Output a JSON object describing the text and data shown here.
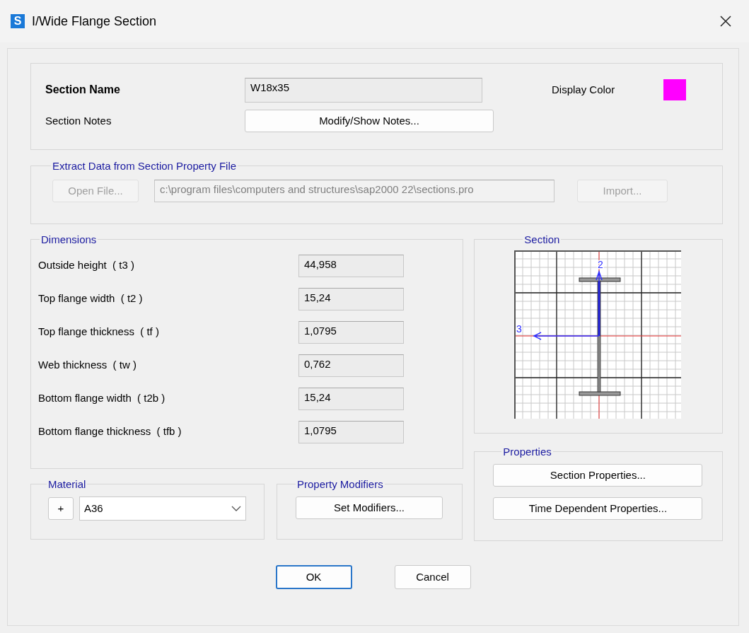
{
  "window": {
    "title": "I/Wide Flange Section",
    "app_icon": "S"
  },
  "section": {
    "name_label": "Section Name",
    "name_value": "W18x35",
    "notes_label": "Section Notes",
    "notes_button": "Modify/Show Notes...",
    "display_color": {
      "label": "Display Color",
      "color": "#ff00ff"
    }
  },
  "extract": {
    "title": "Extract Data from Section Property File",
    "open_button": {
      "label": "Open File...",
      "disabled": true
    },
    "file_path": {
      "value": "c:\\program files\\computers and structures\\sap2000 22\\sections.pro",
      "disabled": true
    },
    "import_button": {
      "label": "Import...",
      "disabled": true
    }
  },
  "dimensions": {
    "title": "Dimensions",
    "rows": [
      {
        "label": "Outside height  ( t3 )",
        "value": "44,958"
      },
      {
        "label": "Top flange width  ( t2 )",
        "value": "15,24"
      },
      {
        "label": "Top flange thickness  ( tf )",
        "value": "1,0795"
      },
      {
        "label": "Web thickness  ( tw )",
        "value": "0,762"
      },
      {
        "label": "Bottom flange width  ( t2b )",
        "value": "15,24"
      },
      {
        "label": "Bottom flange thickness  ( tfb )",
        "value": "1,0795"
      }
    ]
  },
  "section_view": {
    "title": "Section",
    "axis_2": "2",
    "axis_3": "3"
  },
  "properties": {
    "title": "Properties",
    "buttons": [
      "Section Properties...",
      "Time Dependent Properties..."
    ]
  },
  "material": {
    "title": "Material",
    "add_button": "+",
    "value": "A36"
  },
  "modifiers": {
    "title": "Property Modifiers",
    "button": "Set Modifiers..."
  },
  "buttons": [
    {
      "label": "OK",
      "default": true
    },
    {
      "label": "Cancel",
      "default": false
    }
  ]
}
